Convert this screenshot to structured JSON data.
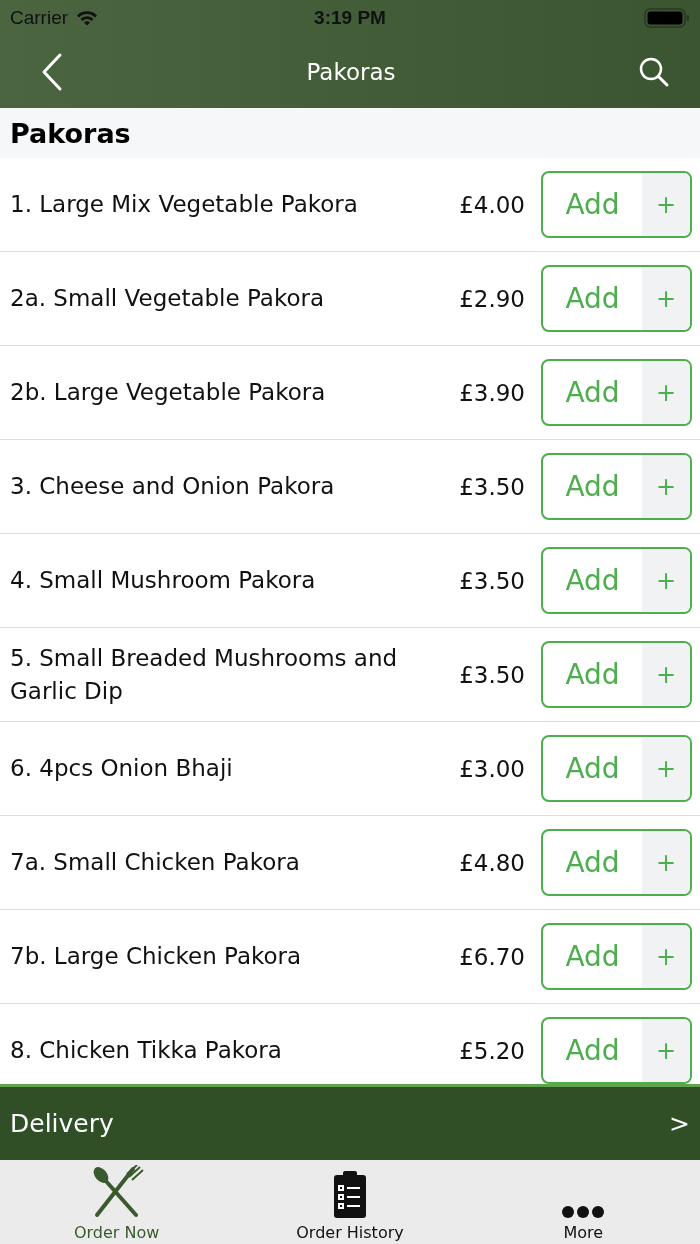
{
  "status_bar": {
    "carrier": "Carrier",
    "time": "3:19 PM"
  },
  "nav": {
    "title": "Pakoras"
  },
  "section": {
    "title": "Pakoras"
  },
  "items": [
    {
      "name": "1. Large Mix Vegetable Pakora",
      "price": "£4.00",
      "add": "Add",
      "plus": "+"
    },
    {
      "name": "2a. Small Vegetable Pakora",
      "price": "£2.90",
      "add": "Add",
      "plus": "+"
    },
    {
      "name": "2b. Large Vegetable Pakora",
      "price": "£3.90",
      "add": "Add",
      "plus": "+"
    },
    {
      "name": "3. Cheese and Onion Pakora",
      "price": "£3.50",
      "add": "Add",
      "plus": "+"
    },
    {
      "name": "4. Small Mushroom Pakora",
      "price": "£3.50",
      "add": "Add",
      "plus": "+"
    },
    {
      "name": "5. Small Breaded Mushrooms and Garlic Dip",
      "price": "£3.50",
      "add": "Add",
      "plus": "+"
    },
    {
      "name": "6. 4pcs Onion Bhaji",
      "price": "£3.00",
      "add": "Add",
      "plus": "+"
    },
    {
      "name": "7a. Small Chicken Pakora",
      "price": "£4.80",
      "add": "Add",
      "plus": "+"
    },
    {
      "name": "7b. Large Chicken Pakora",
      "price": "£6.70",
      "add": "Add",
      "plus": "+"
    },
    {
      "name": "8. Chicken Tikka Pakora",
      "price": "£5.20",
      "add": "Add",
      "plus": "+"
    }
  ],
  "delivery_bar": {
    "label": "Delivery",
    "chevron": ">"
  },
  "tabs": [
    {
      "label": "Order Now",
      "kind": "cutlery",
      "selected": true
    },
    {
      "label": "Order History",
      "kind": "clipboard",
      "selected": false
    },
    {
      "label": "More",
      "kind": "dots",
      "selected": false
    }
  ]
}
